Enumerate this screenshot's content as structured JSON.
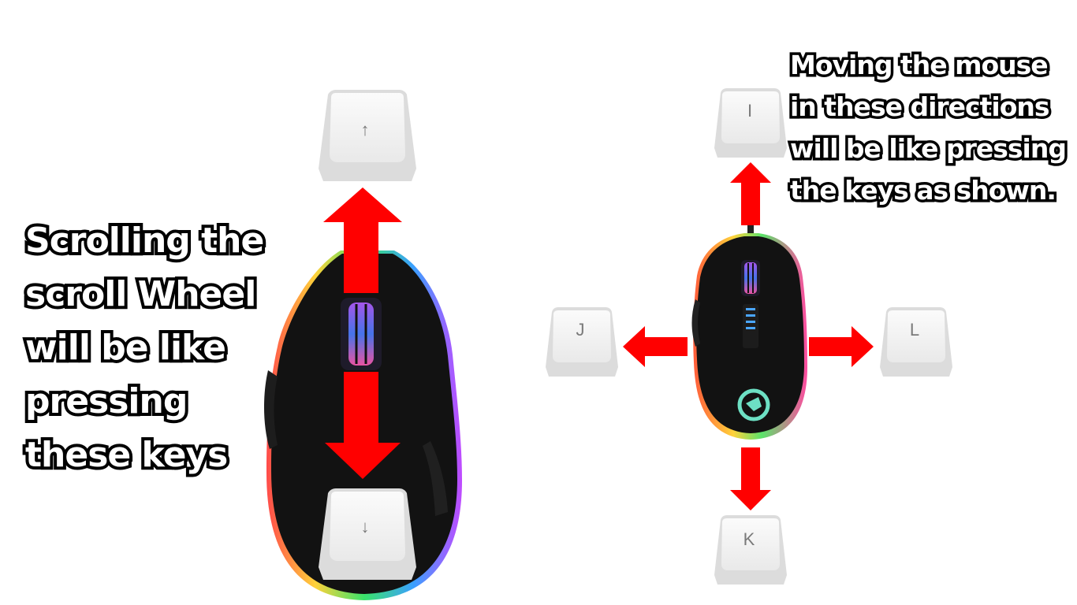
{
  "captions": {
    "left": [
      "Scrolling the",
      "scroll Wheel",
      "will be like",
      "pressing",
      "these keys"
    ],
    "right": [
      "Moving the mouse",
      "in these directions",
      "will be like pressing",
      "the keys as shown."
    ]
  },
  "keys": {
    "up": "↑",
    "down": "↓",
    "i": "I",
    "j": "J",
    "k": "K",
    "l": "L"
  },
  "colors": {
    "arrow": "#ff0000",
    "mouse_body": "#121212",
    "keycap_top": "#f4f4f4",
    "keycap_side": "#dcdcdc",
    "legend": "#7a7a7a",
    "logo": "#6de0c4"
  },
  "icons": {
    "scroll_up_arrow": "double-headed-vertical-arrow",
    "mouse": "rgb-gaming-mouse"
  }
}
